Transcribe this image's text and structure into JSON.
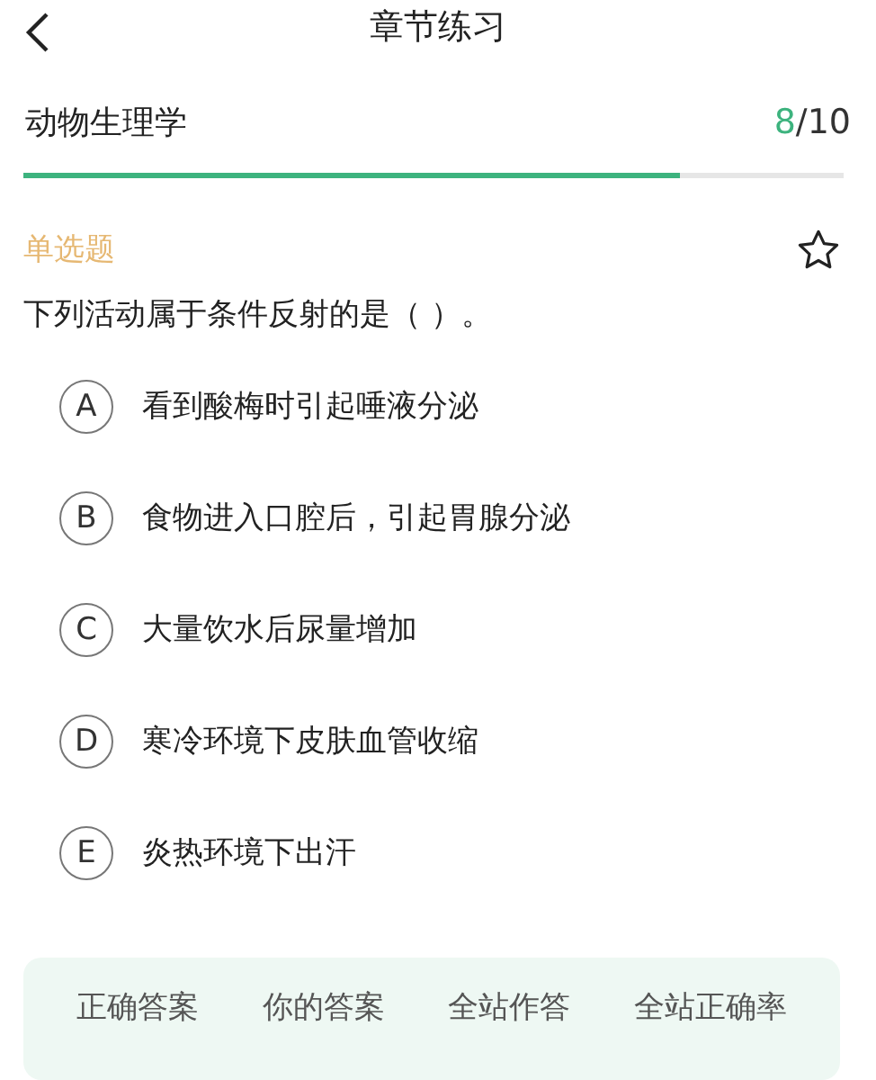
{
  "header": {
    "title": "章节练习"
  },
  "progress": {
    "subject": "动物生理学",
    "current": "8",
    "total": "/10",
    "level": 0.8
  },
  "question": {
    "type_label": "单选题",
    "starred": false,
    "text": "下列活动属于条件反射的是（ ）。",
    "options": [
      {
        "letter": "A",
        "text": "看到酸梅时引起唾液分泌",
        "selected": false
      },
      {
        "letter": "B",
        "text": "食物进入口腔后，引起胃腺分泌",
        "selected": false
      },
      {
        "letter": "C",
        "text": "大量饮水后尿量增加",
        "selected": false
      },
      {
        "letter": "D",
        "text": "寒冷环境下皮肤血管收缩",
        "selected": false
      },
      {
        "letter": "E",
        "text": "炎热环境下出汗",
        "selected": false
      }
    ]
  },
  "stats": {
    "columns": [
      "正确答案",
      "你的答案",
      "全站作答",
      "全站正确率"
    ]
  }
}
